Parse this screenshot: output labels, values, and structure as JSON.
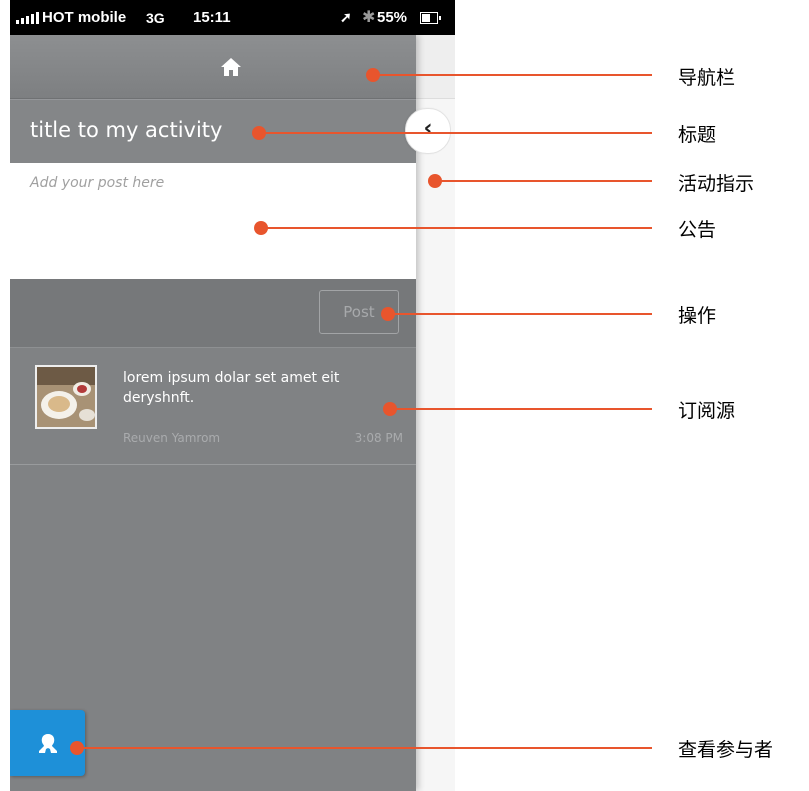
{
  "status_bar": {
    "carrier": "HOT mobile",
    "network": "3G",
    "time": "15:11",
    "battery": "55%"
  },
  "feed_item": {
    "text": "lorem ipsum dolar set amet eit deryshnft.",
    "author": "Reuven Yamrom",
    "time": "3:08 PM"
  },
  "activity": {
    "title": "title to my activity",
    "post_placeholder": "Add your post here",
    "post_button": "Post"
  },
  "annotations": [
    "导航栏",
    "标题",
    "活动指示",
    "公告",
    "操作",
    "订阅源",
    "查看参与者"
  ],
  "colors": {
    "annotation": "#e8552d",
    "participants_button": "#1e90d8"
  },
  "icons": {
    "navbar": "home-icon",
    "side_tab": "chevron-left-icon",
    "participants": "participants-icon"
  }
}
